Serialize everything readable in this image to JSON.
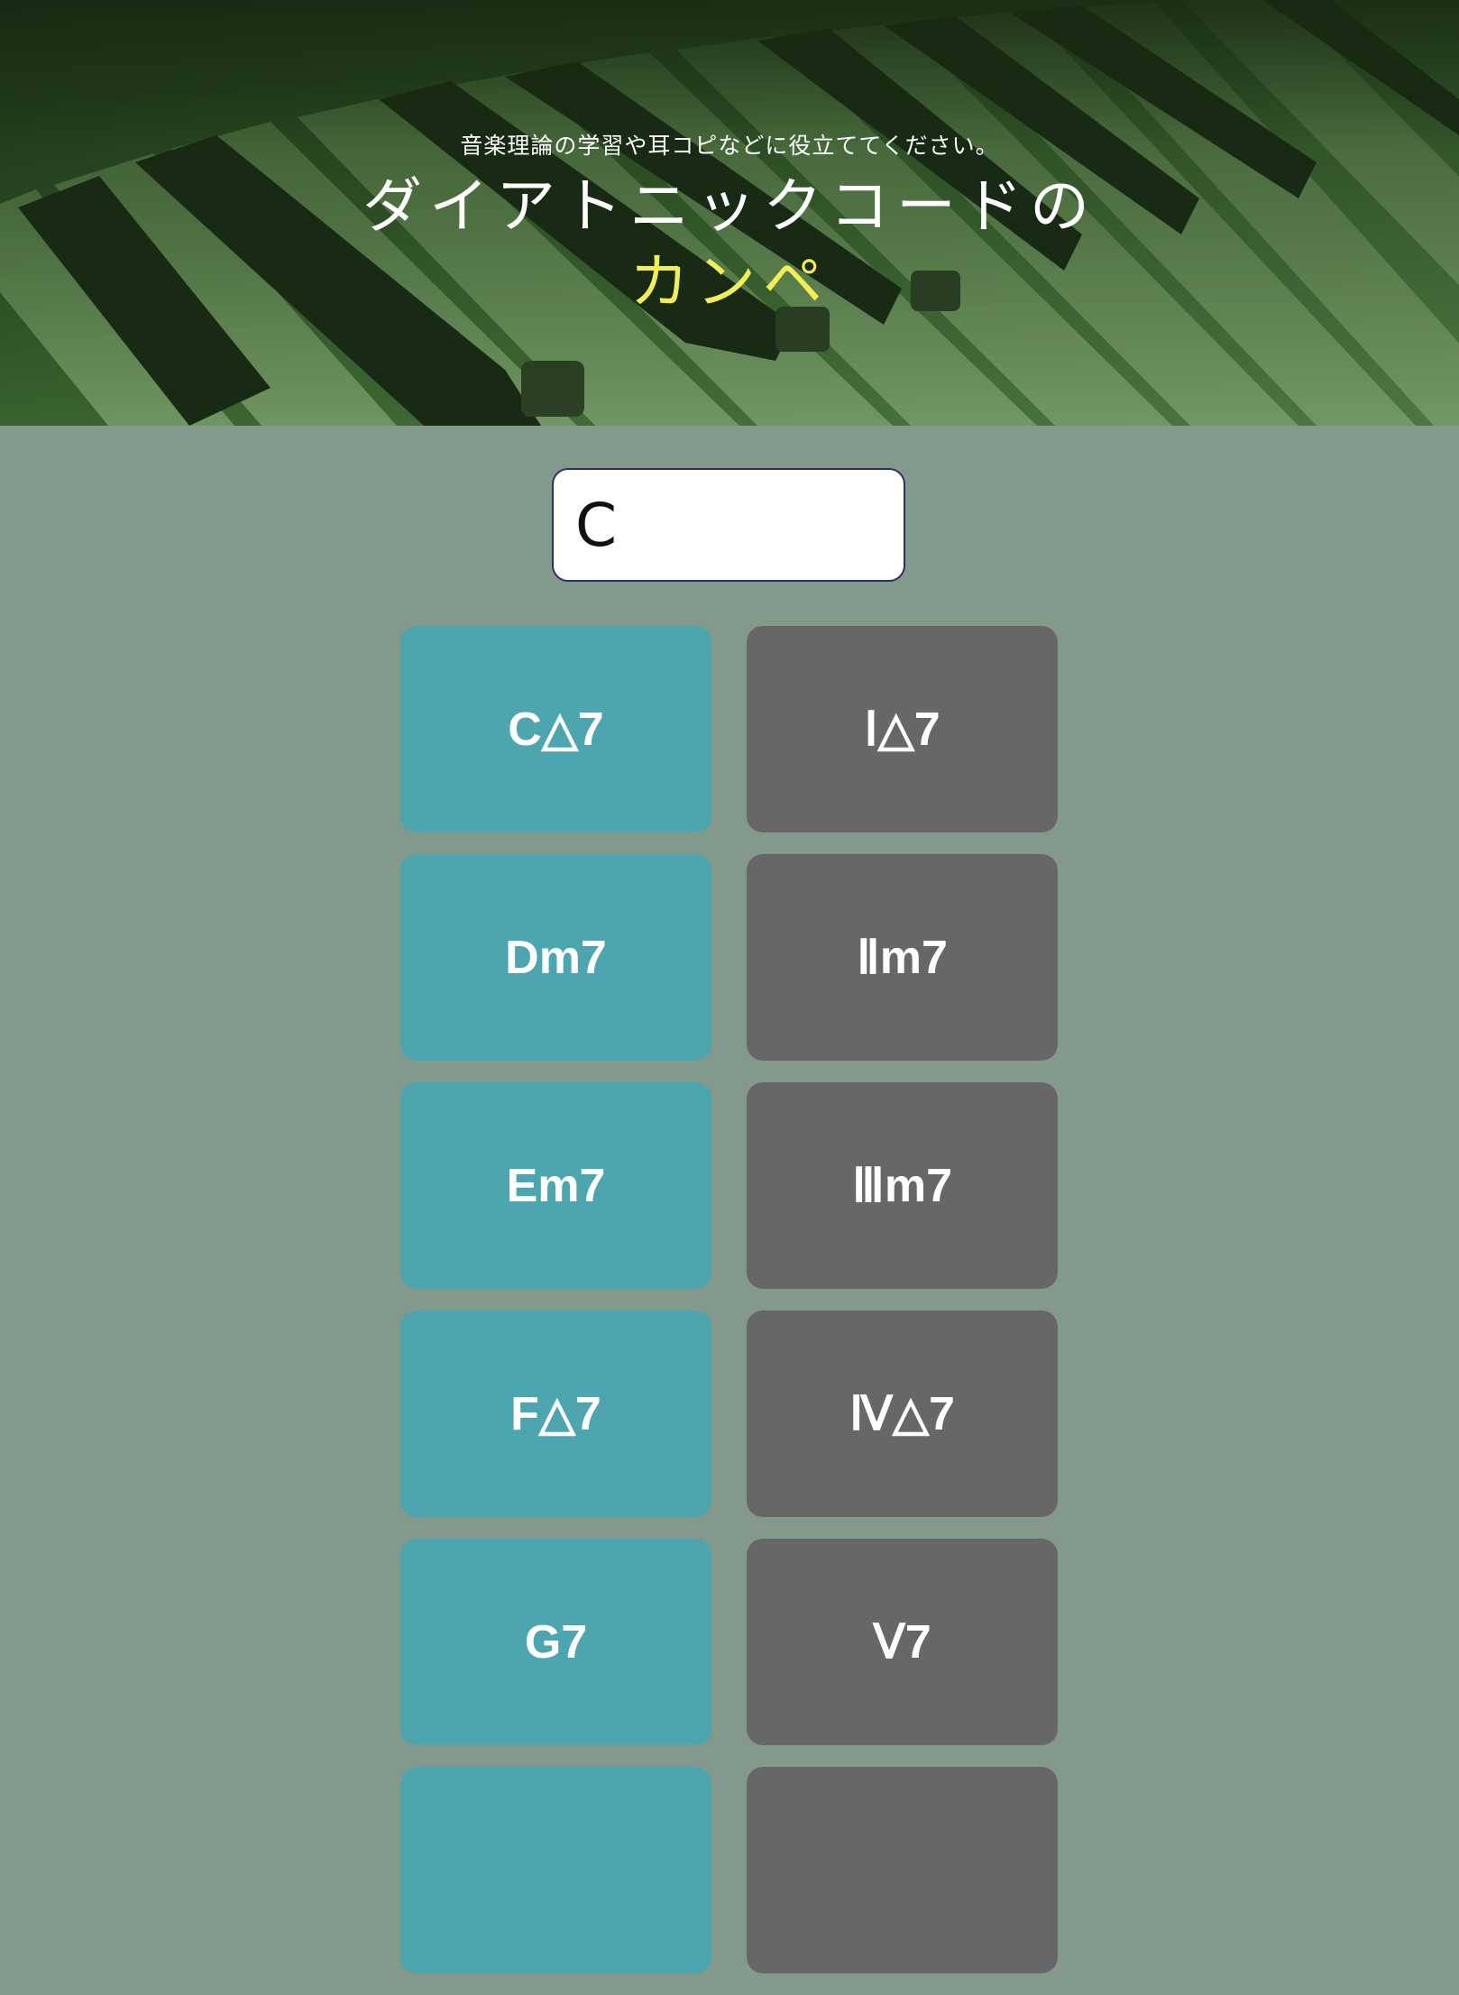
{
  "hero": {
    "subtitle": "音楽理論の学習や耳コピなどに役立ててください。",
    "title": "ダイアトニックコードの",
    "title_accent": "カンペ",
    "accent_color": "#f3ee55",
    "background_image": "piano-keys-photo"
  },
  "key_input": {
    "value": "C"
  },
  "chords": [
    {
      "name": "C△7",
      "degree": "Ⅰ△7"
    },
    {
      "name": "Dm7",
      "degree": "Ⅱm7"
    },
    {
      "name": "Em7",
      "degree": "Ⅲm7"
    },
    {
      "name": "F△7",
      "degree": "Ⅳ△7"
    },
    {
      "name": "G7",
      "degree": "Ⅴ7"
    },
    {
      "name": "",
      "degree": ""
    }
  ],
  "colors": {
    "page_background": "#83998b",
    "chord_name_card": "#4da6af",
    "degree_card": "#676767",
    "input_border": "#2a2f6b"
  }
}
